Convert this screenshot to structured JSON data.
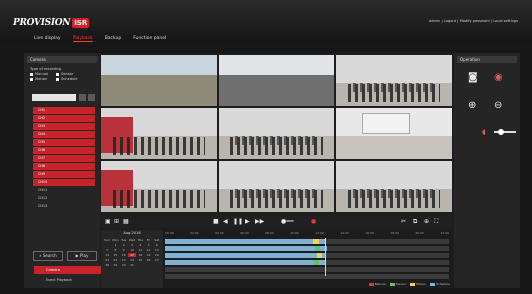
{
  "header": {
    "brand": "PROVISION",
    "brand_badge": "ISR",
    "user_info": "admin | Logout | Modify password | Local settings",
    "tabs": [
      {
        "label": "Live display",
        "active": false
      },
      {
        "label": "Playback",
        "active": true
      },
      {
        "label": "Backup",
        "active": false
      },
      {
        "label": "Function panel",
        "active": false
      }
    ]
  },
  "left_panel": {
    "title": "Camera",
    "record_type_title": "Type of recording",
    "record_types": [
      "Manual",
      "Sensor",
      "Motion",
      "Schedule"
    ],
    "search_placeholder": "",
    "channels": [
      {
        "label": "CH1",
        "selected": true
      },
      {
        "label": "CH2",
        "selected": true
      },
      {
        "label": "CH3",
        "selected": true
      },
      {
        "label": "CH4",
        "selected": true
      },
      {
        "label": "CH5",
        "selected": true
      },
      {
        "label": "CH6",
        "selected": true
      },
      {
        "label": "CH7",
        "selected": true
      },
      {
        "label": "CH8",
        "selected": true
      },
      {
        "label": "CH9",
        "selected": true
      },
      {
        "label": "CH10",
        "selected": true
      },
      {
        "label": "CH11",
        "selected": false
      },
      {
        "label": "CH12",
        "selected": false
      },
      {
        "label": "CH13",
        "selected": false
      }
    ],
    "buttons": {
      "search": "Search",
      "play": "Play"
    },
    "bottom_items": [
      "Camera",
      "Event Playback"
    ]
  },
  "right_panel": {
    "title": "Operation"
  },
  "timeline": {
    "calendar_title": "Aug 2016",
    "weekdays": [
      "Sun",
      "Mon",
      "Tue",
      "Wed",
      "Thu",
      "Fri",
      "Sat"
    ],
    "days": [
      "",
      "1",
      "2",
      "3",
      "4",
      "5",
      "6",
      "7",
      "8",
      "9",
      "10",
      "11",
      "12",
      "13",
      "14",
      "15",
      "16",
      "17",
      "18",
      "19",
      "20",
      "21",
      "22",
      "23",
      "24",
      "25",
      "26",
      "27",
      "28",
      "29",
      "30",
      "31",
      "",
      "",
      ""
    ],
    "selected_day": "17",
    "hours": [
      "00:00",
      "02:00",
      "04:00",
      "06:00",
      "08:00",
      "10:00",
      "12:00",
      "14:00",
      "16:00",
      "18:00",
      "20:00",
      "22:00"
    ],
    "legend": [
      "Manual",
      "Sensor",
      "Motion",
      "Schedule"
    ]
  },
  "colors": {
    "accent": "#c8232a",
    "record": "#7fb0d6",
    "motion": "#e6d84a",
    "sensor": "#5fc26b"
  }
}
